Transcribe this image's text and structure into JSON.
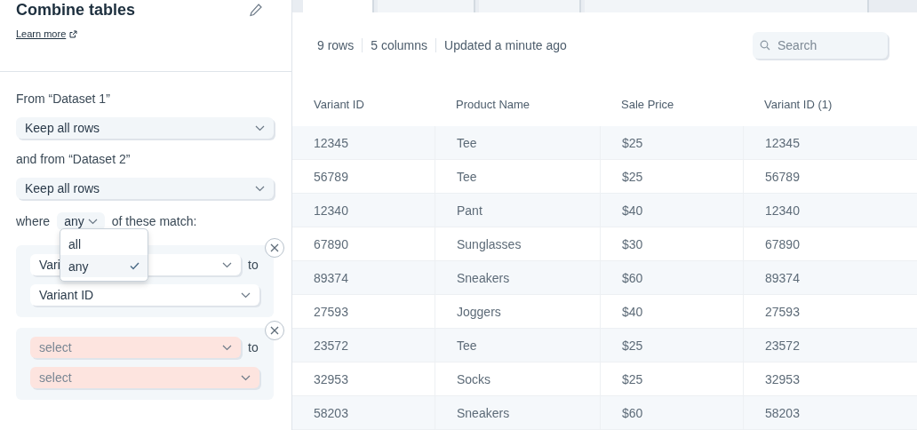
{
  "panel": {
    "title": "Combine tables",
    "learn_more": "Learn more",
    "source_1": {
      "label": "From “Dataset 1”",
      "value": "Keep all rows"
    },
    "source_2": {
      "label": "and from “Dataset 2”",
      "value": "Keep all rows"
    },
    "match": {
      "prefix": "where",
      "value": "any",
      "suffix": "of these match:",
      "expanded": true,
      "options": [
        {
          "label": "all",
          "selected": false
        },
        {
          "label": "any",
          "selected": true
        }
      ]
    },
    "conditions": [
      {
        "left": "Vari",
        "connector": "to",
        "right": "Variant ID",
        "invalid": false
      },
      {
        "left": "select",
        "connector": "to",
        "right": "select",
        "invalid": true
      }
    ]
  },
  "tabs": [
    {
      "selected": true
    },
    {
      "selected": false
    },
    {
      "selected": false
    },
    {
      "selected": false
    }
  ],
  "summary": [
    "9 rows",
    "5 columns",
    "Updated a minute ago"
  ],
  "search": {
    "placeholder": "Search"
  },
  "table": {
    "columns": [
      "Variant ID",
      "Product Name",
      "Sale Price",
      "Variant ID (1)"
    ],
    "rows": [
      [
        "12345",
        "Tee",
        "$25",
        "12345"
      ],
      [
        "56789",
        "Tee",
        "$25",
        "56789"
      ],
      [
        "12340",
        "Pant",
        "$40",
        "12340"
      ],
      [
        "67890",
        "Sunglasses",
        "$30",
        "67890"
      ],
      [
        "89374",
        "Sneakers",
        "$60",
        "89374"
      ],
      [
        "27593",
        "Joggers",
        "$40",
        "27593"
      ],
      [
        "23572",
        "Tee",
        "$25",
        "23572"
      ],
      [
        "32953",
        "Socks",
        "$25",
        "32953"
      ],
      [
        "58203",
        "Sneakers",
        "$60",
        "58203"
      ]
    ]
  }
}
